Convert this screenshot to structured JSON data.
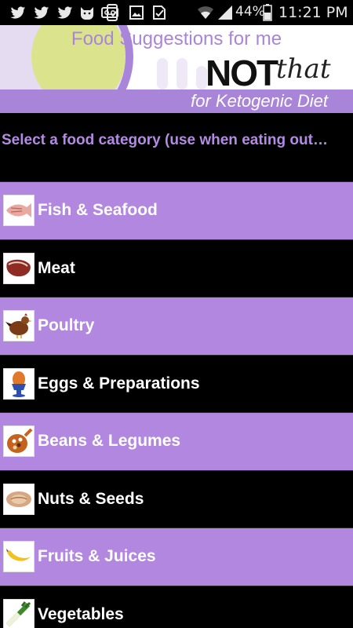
{
  "status_bar": {
    "battery_percent": "44%",
    "time": "11:21 PM",
    "icons": [
      "twitter-icon",
      "twitter-icon",
      "twitter-icon",
      "cat-icon",
      "voicemail-icon",
      "phone-icon",
      "image-icon",
      "check-icon",
      "wifi-icon",
      "signal-icon",
      "battery-icon"
    ]
  },
  "header": {
    "title": "Food Suggestions for me",
    "logo_word_not": "NOT",
    "logo_word_that": "that",
    "subtitle": "for Ketogenic Diet"
  },
  "instruction": "Select a food category (use when eating out…",
  "categories": [
    {
      "label": "Fish & Seafood",
      "icon": "fish-icon"
    },
    {
      "label": "Meat",
      "icon": "steak-icon"
    },
    {
      "label": "Poultry",
      "icon": "chicken-icon"
    },
    {
      "label": "Eggs & Preparations",
      "icon": "egg-icon"
    },
    {
      "label": "Beans & Legumes",
      "icon": "beans-icon"
    },
    {
      "label": "Nuts & Seeds",
      "icon": "nut-icon"
    },
    {
      "label": "Fruits & Juices",
      "icon": "banana-icon"
    },
    {
      "label": "Vegetables",
      "icon": "leek-icon"
    }
  ],
  "colors": {
    "accent_purple": "#b187e0",
    "instruction_purple": "#b48be3",
    "background": "#000000"
  }
}
